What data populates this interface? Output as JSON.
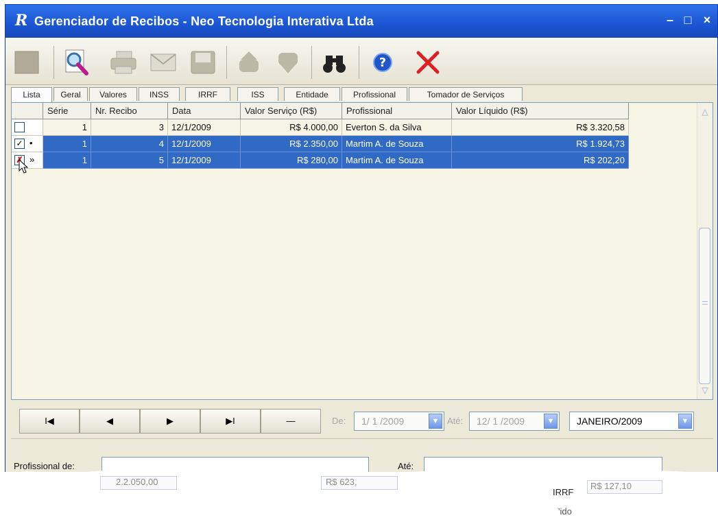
{
  "window": {
    "title": "Gerenciador de Recibos - Neo Tecnologia Interativa Ltda",
    "app_icon": "R",
    "minimize_glyph": "–",
    "maximize_glyph": "□",
    "close_glyph": "×"
  },
  "toolbar": {
    "buttons": [
      {
        "name": "new-record-icon",
        "enabled": false
      },
      {
        "name": "preview-magnifier-icon",
        "enabled": true
      },
      {
        "name": "printer-icon",
        "enabled": false
      },
      {
        "name": "email-envelope-icon",
        "enabled": false
      },
      {
        "name": "save-disk-icon",
        "enabled": false
      },
      {
        "name": "upload-icon",
        "enabled": false
      },
      {
        "name": "download-icon",
        "enabled": false
      },
      {
        "name": "binoculars-icon",
        "enabled": true
      },
      {
        "name": "help-icon",
        "enabled": true
      },
      {
        "name": "delete-x-icon",
        "enabled": true
      }
    ]
  },
  "tabs": [
    "Lista",
    "Geral",
    "Valores",
    "INSS",
    "IRRF",
    "ISS",
    "Entidade",
    "Profissional",
    "Tomador de Serviços"
  ],
  "active_tab": "Lista",
  "grid": {
    "columns": [
      "Série",
      "Nr. Recibo",
      "Data",
      "Valor Serviço (R$)",
      "Profissional",
      "Valor Líquido (R$)"
    ],
    "rows": [
      {
        "checked": false,
        "marker": "",
        "serie": "1",
        "recibo": "3",
        "data": "12/1/2009",
        "valor": "R$ 4.000,00",
        "profissional": "Everton S. da Silva",
        "liquido": "R$ 3.320,58",
        "selected": false
      },
      {
        "checked": true,
        "marker": "•",
        "serie": "1",
        "recibo": "4",
        "data": "12/1/2009",
        "valor": "R$ 2.350,00",
        "profissional": "Martim A. de Souza",
        "liquido": "R$ 1.924,73",
        "selected": true
      },
      {
        "checked": true,
        "marker": "»",
        "serie": "1",
        "recibo": "5",
        "data": "12/1/2009",
        "valor": "R$ 280,00",
        "profissional": "Martim A. de Souza",
        "liquido": "R$ 202,20",
        "selected": true
      }
    ]
  },
  "navigation": {
    "first": "I◀",
    "prev": "◀",
    "next": "▶",
    "last": "▶I",
    "delete": "—",
    "de_label": "De:",
    "de_value": "1/ 1 /2009",
    "ate_label": "Até:",
    "ate_value": "12/ 1 /2009",
    "period_value": "JANEIRO/2009"
  },
  "filters": {
    "profissional_de_label": "Profissional de:",
    "ate_label": "Até:",
    "irrf_label": "IRRF",
    "partial_value_1": "2.2.050,00",
    "partial_value_2": "R$ 623,",
    "partial_value_3": "R$ 127,10",
    "partial_footer": "'ido"
  },
  "colors": {
    "titlebar": "#2f73e8",
    "selection": "#316ac5",
    "grid_bg": "#f6f4e4",
    "delete_red": "#e02020"
  }
}
